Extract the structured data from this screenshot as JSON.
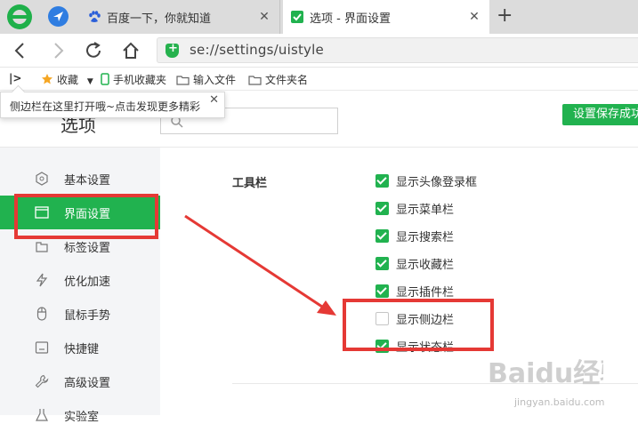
{
  "tabs": [
    {
      "title": "百度一下，你就知道",
      "icon": "baidu-paw-icon"
    },
    {
      "title": "选项 - 界面设置",
      "icon": "settings-icon"
    }
  ],
  "address": {
    "url": "se://settings/uistyle"
  },
  "bookmarks": {
    "items": [
      {
        "label": "收藏",
        "icon": "star-icon"
      },
      {
        "label": "手机收藏夹",
        "icon": "phone-icon"
      },
      {
        "label": "输入文件",
        "icon": "folder-icon"
      },
      {
        "label": "文件夹名",
        "icon": "folder-icon"
      }
    ]
  },
  "tooltip": {
    "text": "侧边栏在这里打开哦~点击发现更多精彩"
  },
  "settings": {
    "title": "选项",
    "save_status": "设置保存成功",
    "sidebar": [
      {
        "label": "基本设置",
        "icon": "hexagon-icon"
      },
      {
        "label": "界面设置",
        "icon": "window-icon",
        "active": true
      },
      {
        "label": "标签设置",
        "icon": "tab-icon"
      },
      {
        "label": "优化加速",
        "icon": "lightning-icon"
      },
      {
        "label": "鼠标手势",
        "icon": "mouse-icon"
      },
      {
        "label": "快捷键",
        "icon": "keyboard-icon"
      },
      {
        "label": "高级设置",
        "icon": "wrench-icon"
      },
      {
        "label": "实验室",
        "icon": "flask-icon"
      }
    ],
    "toolbar_section": {
      "title": "工具栏",
      "options": [
        {
          "label": "显示头像登录框",
          "checked": true
        },
        {
          "label": "显示菜单栏",
          "checked": true
        },
        {
          "label": "显示搜索栏",
          "checked": true
        },
        {
          "label": "显示收藏栏",
          "checked": true
        },
        {
          "label": "显示插件栏",
          "checked": true
        },
        {
          "label": "显示侧边栏",
          "checked": false
        },
        {
          "label": "显示状态栏",
          "checked": true
        }
      ]
    }
  },
  "watermark": {
    "text": "Baidu经验",
    "sub": "jingyan.baidu.com"
  },
  "colors": {
    "accent": "#21b24f",
    "annotation": "#e53935"
  }
}
